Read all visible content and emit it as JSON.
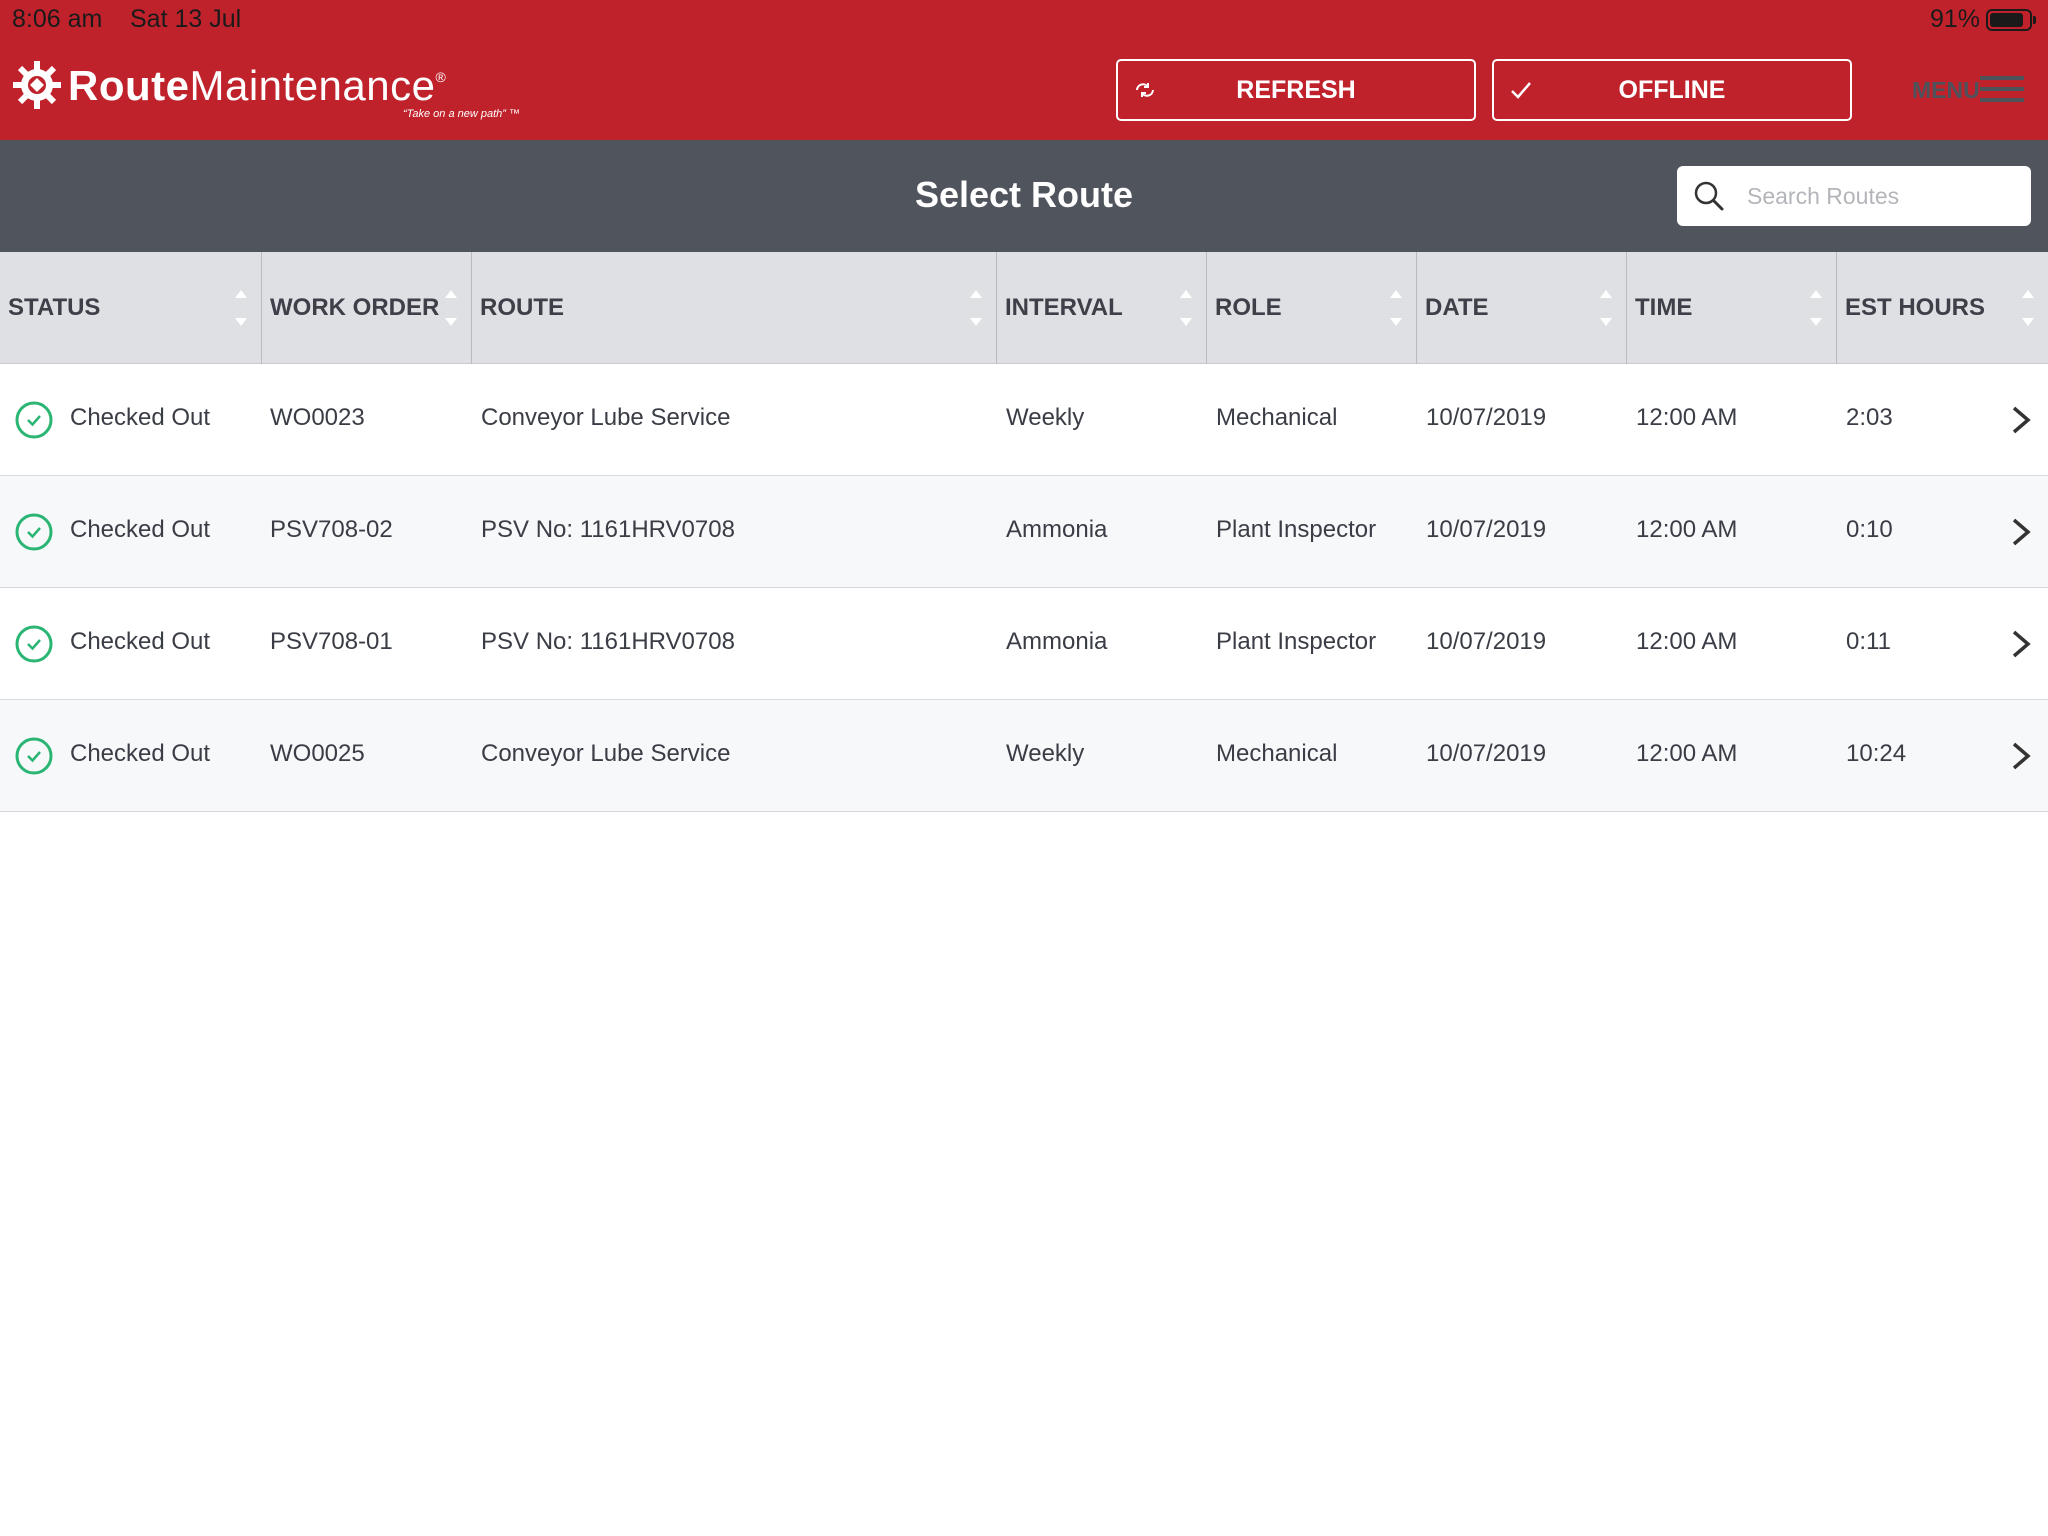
{
  "statusbar": {
    "time": "8:06 am",
    "date": "Sat 13 Jul",
    "battery": "91%"
  },
  "brand": {
    "name_bold": "Route",
    "name_regular": "Maintenance",
    "registered": "®",
    "tagline": "“Take on a new path” ™"
  },
  "header": {
    "refresh_label": "REFRESH",
    "offline_label": "OFFLINE",
    "menu_label": "MENU"
  },
  "page": {
    "title": "Select Route"
  },
  "search": {
    "placeholder": "Search Routes",
    "value": ""
  },
  "table": {
    "columns": [
      "STATUS",
      "WORK ORDER",
      "ROUTE",
      "INTERVAL",
      "ROLE",
      "DATE",
      "TIME",
      "EST HOURS"
    ],
    "rows": [
      {
        "status": "Checked Out",
        "work_order": "WO0023",
        "route": "Conveyor Lube Service",
        "interval": "Weekly",
        "role": "Mechanical",
        "date": "10/07/2019",
        "time": "12:00 AM",
        "est_hours": "2:03"
      },
      {
        "status": "Checked Out",
        "work_order": "PSV708-02",
        "route": "PSV No: 1161HRV0708",
        "interval": "Ammonia",
        "role": "Plant Inspector",
        "date": "10/07/2019",
        "time": "12:00 AM",
        "est_hours": "0:10"
      },
      {
        "status": "Checked Out",
        "work_order": "PSV708-01",
        "route": "PSV No: 1161HRV0708",
        "interval": "Ammonia",
        "role": "Plant Inspector",
        "date": "10/07/2019",
        "time": "12:00 AM",
        "est_hours": "0:11"
      },
      {
        "status": "Checked Out",
        "work_order": "WO0025",
        "route": "Conveyor Lube Service",
        "interval": "Weekly",
        "role": "Mechanical",
        "date": "10/07/2019",
        "time": "12:00 AM",
        "est_hours": "10:24"
      }
    ]
  },
  "colors": {
    "brand_red": "#c0222c",
    "title_gray": "#50545d",
    "header_gray": "#dfe0e4",
    "status_green": "#2bb573"
  },
  "icons": {
    "refresh": "refresh-icon",
    "offline": "check-icon",
    "menu": "hamburger-icon",
    "search": "search-icon",
    "status": "check-circle-icon",
    "row_action": "chevron-right-icon"
  }
}
